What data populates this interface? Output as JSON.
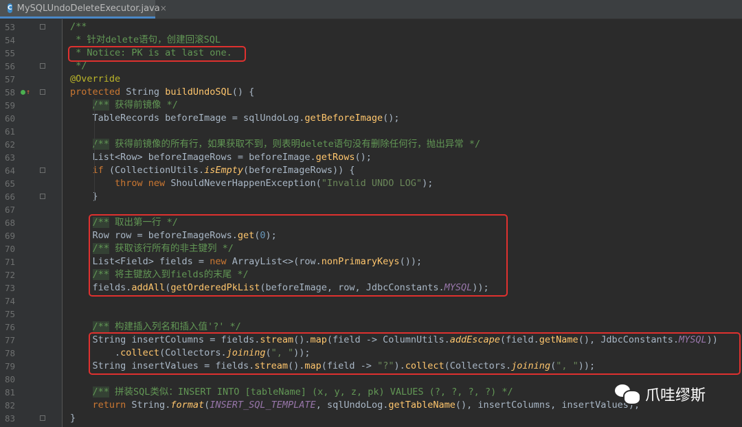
{
  "tab": {
    "title": "MySQLUndoDeleteExecutor.java",
    "icon": "C",
    "close": "×"
  },
  "watermark": {
    "text": "爪哇缪斯",
    "icon": "wechat-icon"
  },
  "colors": {
    "keyword": "#cc7832",
    "comment": "#629755",
    "string": "#6a8759",
    "method": "#ffc66d",
    "annotation": "#bbb529",
    "constant": "#9876aa",
    "highlight_box": "#e0312f"
  },
  "lines": [
    {
      "n": "53",
      "parts": [
        [
          "cm",
          "/**"
        ]
      ]
    },
    {
      "n": "54",
      "parts": [
        [
          "cm",
          " * 针对delete语句，创建回滚SQL"
        ]
      ]
    },
    {
      "n": "55",
      "parts": [
        [
          "cm",
          " * Notice: PK is at last one."
        ]
      ]
    },
    {
      "n": "56",
      "parts": [
        [
          "cm",
          " */"
        ]
      ]
    },
    {
      "n": "57",
      "parts": [
        [
          "ann",
          "@Override"
        ]
      ]
    },
    {
      "n": "58",
      "parts": [
        [
          "kw",
          "protected "
        ],
        [
          "p",
          "String "
        ],
        [
          "fn",
          "buildUndoSQL"
        ],
        [
          "p",
          "() {"
        ]
      ]
    },
    {
      "n": "59",
      "parts": [
        [
          "p",
          "    "
        ],
        [
          "hl",
          "/**"
        ],
        [
          "cm",
          " 获得前镜像 */"
        ]
      ]
    },
    {
      "n": "60",
      "parts": [
        [
          "p",
          "    TableRecords beforeImage = sqlUndoLog."
        ],
        [
          "method",
          "getBeforeImage"
        ],
        [
          "p",
          "();"
        ]
      ]
    },
    {
      "n": "61",
      "parts": []
    },
    {
      "n": "62",
      "parts": [
        [
          "p",
          "    "
        ],
        [
          "hl",
          "/**"
        ],
        [
          "cm",
          " 获得前镜像的所有行，如果获取不到，则表明delete语句没有删除任何行，抛出异常 */"
        ]
      ]
    },
    {
      "n": "63",
      "parts": [
        [
          "p",
          "    List<Row> beforeImageRows = beforeImage."
        ],
        [
          "method",
          "getRows"
        ],
        [
          "p",
          "();"
        ]
      ]
    },
    {
      "n": "64",
      "parts": [
        [
          "p",
          "    "
        ],
        [
          "kw",
          "if "
        ],
        [
          "p",
          "(CollectionUtils."
        ],
        [
          "mi",
          "isEmpty"
        ],
        [
          "p",
          "(beforeImageRows)) {"
        ]
      ]
    },
    {
      "n": "65",
      "parts": [
        [
          "p",
          "        "
        ],
        [
          "kw",
          "throw new "
        ],
        [
          "p",
          "ShouldNeverHappenException("
        ],
        [
          "str",
          "\"Invalid UNDO LOG\""
        ],
        [
          "p",
          ");"
        ]
      ]
    },
    {
      "n": "66",
      "parts": [
        [
          "p",
          "    }"
        ]
      ]
    },
    {
      "n": "67",
      "parts": []
    },
    {
      "n": "68",
      "parts": [
        [
          "p",
          "    "
        ],
        [
          "hl",
          "/**"
        ],
        [
          "cm",
          " 取出第一行 */"
        ]
      ]
    },
    {
      "n": "69",
      "parts": [
        [
          "p",
          "    Row row = beforeImageRows."
        ],
        [
          "method",
          "get"
        ],
        [
          "p",
          "("
        ],
        [
          "num",
          "0"
        ],
        [
          "p",
          ");"
        ]
      ]
    },
    {
      "n": "70",
      "parts": [
        [
          "p",
          "    "
        ],
        [
          "hl",
          "/**"
        ],
        [
          "cm",
          " 获取该行所有的非主键列 */"
        ]
      ]
    },
    {
      "n": "71",
      "parts": [
        [
          "p",
          "    List<Field> fields = "
        ],
        [
          "kw",
          "new "
        ],
        [
          "p",
          "ArrayList<>(row."
        ],
        [
          "method",
          "nonPrimaryKeys"
        ],
        [
          "p",
          "());"
        ]
      ]
    },
    {
      "n": "72",
      "parts": [
        [
          "p",
          "    "
        ],
        [
          "hl",
          "/**"
        ],
        [
          "cm",
          " 将主键放入到fields的末尾 */"
        ]
      ]
    },
    {
      "n": "73",
      "parts": [
        [
          "p",
          "    fields."
        ],
        [
          "method",
          "addAll"
        ],
        [
          "p",
          "("
        ],
        [
          "method",
          "getOrderedPkList"
        ],
        [
          "p",
          "(beforeImage, row, JdbcConstants."
        ],
        [
          "const",
          "MYSQL"
        ],
        [
          "p",
          "));"
        ]
      ]
    },
    {
      "n": "74",
      "parts": []
    },
    {
      "n": "75",
      "parts": []
    },
    {
      "n": "76",
      "parts": [
        [
          "p",
          "    "
        ],
        [
          "hl",
          "/**"
        ],
        [
          "cm",
          " 构建插入列名和插入值'?' */"
        ]
      ]
    },
    {
      "n": "77",
      "parts": [
        [
          "p",
          "    String insertColumns = fields."
        ],
        [
          "method",
          "stream"
        ],
        [
          "p",
          "()."
        ],
        [
          "method",
          "map"
        ],
        [
          "p",
          "(field -> ColumnUtils."
        ],
        [
          "mi",
          "addEscape"
        ],
        [
          "p",
          "(field."
        ],
        [
          "method",
          "getName"
        ],
        [
          "p",
          "(), JdbcConstants."
        ],
        [
          "const",
          "MYSQL"
        ],
        [
          "p",
          "))"
        ]
      ]
    },
    {
      "n": "78",
      "parts": [
        [
          "p",
          "        ."
        ],
        [
          "method",
          "collect"
        ],
        [
          "p",
          "(Collectors."
        ],
        [
          "mi",
          "joining"
        ],
        [
          "p",
          "("
        ],
        [
          "str",
          "\", \""
        ],
        [
          "p",
          "));"
        ]
      ]
    },
    {
      "n": "79",
      "parts": [
        [
          "p",
          "    String insertValues = fields."
        ],
        [
          "method",
          "stream"
        ],
        [
          "p",
          "()."
        ],
        [
          "method",
          "map"
        ],
        [
          "p",
          "(field -> "
        ],
        [
          "str",
          "\"?\""
        ],
        [
          "p",
          ")."
        ],
        [
          "method",
          "collect"
        ],
        [
          "p",
          "(Collectors."
        ],
        [
          "mi",
          "joining"
        ],
        [
          "p",
          "("
        ],
        [
          "str",
          "\", \""
        ],
        [
          "p",
          "));"
        ]
      ]
    },
    {
      "n": "80",
      "parts": []
    },
    {
      "n": "81",
      "parts": [
        [
          "p",
          "    "
        ],
        [
          "hl",
          "/**"
        ],
        [
          "cm",
          " 拼装SQL类似：INSERT INTO [tableName] (x, y, z, pk) VALUES (?, ?, ?, ?) */"
        ]
      ]
    },
    {
      "n": "82",
      "parts": [
        [
          "p",
          "    "
        ],
        [
          "kw",
          "return "
        ],
        [
          "p",
          "String."
        ],
        [
          "mi",
          "format"
        ],
        [
          "p",
          "("
        ],
        [
          "const",
          "INSERT_SQL_TEMPLATE"
        ],
        [
          "p",
          ", sqlUndoLog."
        ],
        [
          "method",
          "getTableName"
        ],
        [
          "p",
          "(), insertColumns, insertValues);"
        ]
      ]
    },
    {
      "n": "83",
      "parts": [
        [
          "p",
          "}"
        ]
      ]
    }
  ]
}
